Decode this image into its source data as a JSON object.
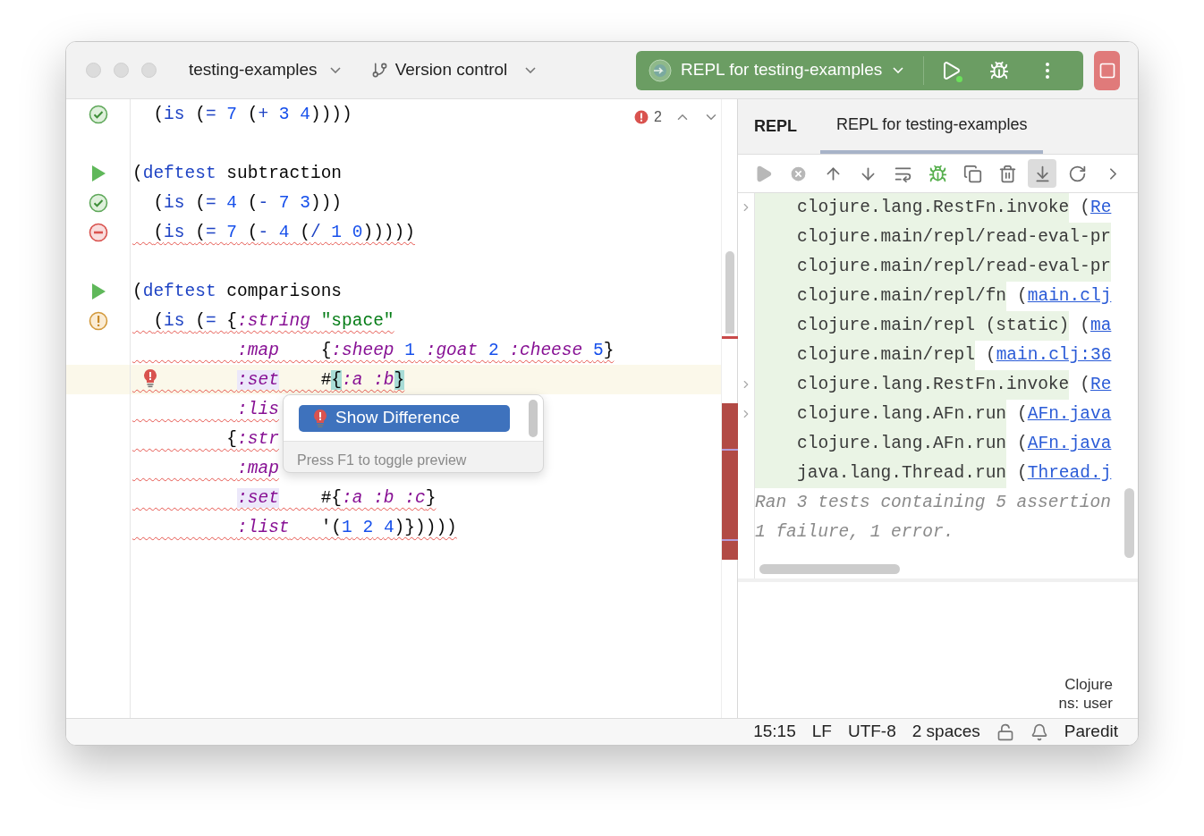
{
  "titlebar": {
    "project": "testing-examples",
    "vcs": "Version control",
    "run_config": "REPL for testing-examples"
  },
  "editor": {
    "problems": "2",
    "lines": [
      {
        "kind": "pass",
        "underlined": false,
        "current": false,
        "bulb": false,
        "tokens": [
          {
            "text": "  (",
            "kind": "plain"
          },
          {
            "text": "is",
            "kind": "fn"
          },
          {
            "text": " (",
            "kind": "plain"
          },
          {
            "text": "=",
            "kind": "fn"
          },
          {
            "text": " 7",
            "kind": "num"
          },
          {
            "text": " (",
            "kind": "plain"
          },
          {
            "text": "+",
            "kind": "fn"
          },
          {
            "text": " 3",
            "kind": "num"
          },
          {
            "text": " 4",
            "kind": "num"
          },
          {
            "text": "))))",
            "kind": "plain"
          }
        ]
      },
      {
        "kind": "plain",
        "current": false,
        "bulb": false
      },
      {
        "kind": "run",
        "underlined": false,
        "current": false,
        "bulb": false,
        "tokens": [
          {
            "text": "(",
            "kind": "plain"
          },
          {
            "text": "deftest",
            "kind": "fn"
          },
          {
            "text": " subtraction",
            "kind": "plain"
          }
        ]
      },
      {
        "kind": "pass",
        "underlined": false,
        "current": false,
        "bulb": false,
        "tokens": [
          {
            "text": "  (",
            "kind": "plain"
          },
          {
            "text": "is",
            "kind": "fn"
          },
          {
            "text": " (",
            "kind": "plain"
          },
          {
            "text": "=",
            "kind": "fn"
          },
          {
            "text": " 4",
            "kind": "num"
          },
          {
            "text": " (",
            "kind": "plain"
          },
          {
            "text": "-",
            "kind": "fn"
          },
          {
            "text": " 7",
            "kind": "num"
          },
          {
            "text": " 3",
            "kind": "num"
          },
          {
            "text": ")))",
            "kind": "plain"
          }
        ]
      },
      {
        "kind": "error",
        "underlined": true,
        "current": false,
        "bulb": false,
        "tokens": [
          {
            "text": "  (",
            "kind": "plain"
          },
          {
            "text": "is",
            "kind": "fn"
          },
          {
            "text": " (",
            "kind": "plain"
          },
          {
            "text": "=",
            "kind": "fn"
          },
          {
            "text": " 7",
            "kind": "num"
          },
          {
            "text": " (",
            "kind": "plain"
          },
          {
            "text": "-",
            "kind": "fn"
          },
          {
            "text": " 4",
            "kind": "num"
          },
          {
            "text": " (",
            "kind": "plain"
          },
          {
            "text": "/",
            "kind": "fn"
          },
          {
            "text": " 1",
            "kind": "num"
          },
          {
            "text": " 0",
            "kind": "num"
          },
          {
            "text": ")))))",
            "kind": "plain"
          }
        ]
      },
      {
        "kind": "plain",
        "current": false,
        "bulb": false
      },
      {
        "kind": "run",
        "underlined": false,
        "current": false,
        "bulb": false,
        "tokens": [
          {
            "text": "(",
            "kind": "plain"
          },
          {
            "text": "deftest",
            "kind": "fn"
          },
          {
            "text": " comparisons",
            "kind": "plain"
          }
        ]
      },
      {
        "kind": "warn",
        "underlined": true,
        "current": false,
        "bulb": false,
        "tokens": [
          {
            "text": "  (",
            "kind": "plain"
          },
          {
            "text": "is",
            "kind": "fn"
          },
          {
            "text": " (",
            "kind": "plain"
          },
          {
            "text": "=",
            "kind": "fn"
          },
          {
            "text": " {",
            "kind": "plain"
          },
          {
            "text": ":string",
            "kind": "keyword"
          },
          {
            "text": " \"space\"",
            "kind": "string"
          }
        ]
      },
      {
        "kind": "plain",
        "underlined": true,
        "current": false,
        "bulb": false,
        "tokens": [
          {
            "text": "          :map",
            "kind": "keyword"
          },
          {
            "text": "    {",
            "kind": "plain"
          },
          {
            "text": ":sheep",
            "kind": "keyword"
          },
          {
            "text": " 1",
            "kind": "num"
          },
          {
            "text": " :goat",
            "kind": "keyword"
          },
          {
            "text": " 2",
            "kind": "num"
          },
          {
            "text": " :cheese",
            "kind": "keyword"
          },
          {
            "text": " 5",
            "kind": "num"
          },
          {
            "text": "}",
            "kind": "plain"
          }
        ]
      },
      {
        "kind": "plain",
        "underlined": true,
        "current": true,
        "bulb": true,
        "tokens": [
          {
            "text": "          :set",
            "kind": "marked"
          },
          {
            "text": "    #",
            "kind": "plain"
          },
          {
            "text": "{",
            "kind": "brace"
          },
          {
            "text": ":a :b",
            "kind": "keyword"
          },
          {
            "text": "}",
            "kind": "brace"
          }
        ]
      },
      {
        "kind": "plain",
        "underlined": true,
        "current": false,
        "bulb": false,
        "tokens": [
          {
            "text": "          :lis",
            "kind": "keyword"
          }
        ]
      },
      {
        "kind": "plain",
        "underlined": true,
        "current": false,
        "bulb": false,
        "tokens": [
          {
            "text": "         {",
            "kind": "plain"
          },
          {
            "text": ":str",
            "kind": "keyword"
          }
        ]
      },
      {
        "kind": "plain",
        "underlined": true,
        "current": false,
        "bulb": false,
        "tokens": [
          {
            "text": "          :map",
            "kind": "keyword"
          }
        ]
      },
      {
        "kind": "plain",
        "underlined": true,
        "current": false,
        "bulb": false,
        "tokens": [
          {
            "text": "          :set",
            "kind": "marked"
          },
          {
            "text": "    #{",
            "kind": "plain"
          },
          {
            "text": ":a :b :c",
            "kind": "keyword"
          },
          {
            "text": "}",
            "kind": "plain"
          }
        ]
      },
      {
        "kind": "plain",
        "underlined": true,
        "current": false,
        "bulb": false,
        "tokens": [
          {
            "text": "          :list",
            "kind": "keyword"
          },
          {
            "text": "   '(",
            "kind": "plain"
          },
          {
            "text": "1",
            "kind": "num"
          },
          {
            "text": " 2",
            "kind": "num"
          },
          {
            "text": " 4",
            "kind": "num"
          },
          {
            "text": ")}))))",
            "kind": "plain"
          }
        ]
      }
    ],
    "popup": {
      "action": "Show Difference",
      "hint": "Press F1 to toggle preview"
    }
  },
  "repl": {
    "title": "REPL",
    "tabs": [
      {
        "label": "REPL for testing-examples",
        "selected": true
      }
    ],
    "toolbar": [
      {
        "disabled": true,
        "selected": false
      },
      {
        "disabled": true,
        "selected": false
      },
      {
        "disabled": false,
        "selected": false
      },
      {
        "disabled": false,
        "selected": false
      },
      {
        "disabled": false,
        "selected": false
      },
      {
        "disabled": false,
        "selected": false
      },
      {
        "disabled": false,
        "selected": false
      },
      {
        "disabled": false,
        "selected": false
      },
      {
        "disabled": false,
        "selected": true
      },
      {
        "disabled": false,
        "selected": false
      },
      {
        "disabled": false,
        "selected": false
      }
    ],
    "trace": [
      {
        "fold": true,
        "text": "clojure.lang.RestFn.invoke",
        "tail": "(",
        "link": "Re"
      },
      {
        "fold": false,
        "text": "clojure.main/repl/read-eval-pr"
      },
      {
        "fold": false,
        "text": "clojure.main/repl/read-eval-pr"
      },
      {
        "fold": false,
        "text": "clojure.main/repl/fn",
        "tail": "(",
        "link": "main.clj"
      },
      {
        "fold": false,
        "text": "clojure.main/repl (static)",
        "tail": "(",
        "link": "ma"
      },
      {
        "fold": false,
        "text": "clojure.main/repl",
        "tail": "(",
        "link": "main.clj:36"
      },
      {
        "fold": true,
        "text": "clojure.lang.RestFn.invoke",
        "tail": "(",
        "link": "Re"
      },
      {
        "fold": true,
        "text": "clojure.lang.AFn.run",
        "tail": "(",
        "link": "AFn.java"
      },
      {
        "fold": false,
        "text": "clojure.lang.AFn.run",
        "tail": "(",
        "link": "AFn.java"
      },
      {
        "fold": false,
        "text": "java.lang.Thread.run",
        "tail": "(",
        "link": "Thread.j"
      }
    ],
    "summary": [
      "Ran 3 tests containing 5 assertion",
      "1 failure, 1 error."
    ],
    "language": "Clojure",
    "namespace": "ns: user"
  },
  "status_bar": {
    "position": "15:15",
    "line_separator": "LF",
    "encoding": "UTF-8",
    "indent": "2 spaces",
    "mode": "Paredit"
  }
}
